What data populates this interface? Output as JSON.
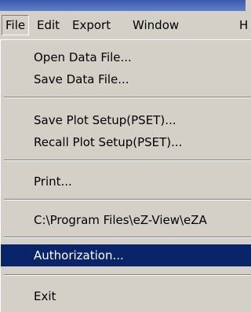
{
  "menubar": {
    "items": [
      {
        "label": "File"
      },
      {
        "label": "Edit"
      },
      {
        "label": "Export"
      },
      {
        "label": "Window"
      },
      {
        "label": "H"
      }
    ]
  },
  "file_menu": {
    "items": [
      {
        "label": "Open Data File..."
      },
      {
        "label": "Save Data File..."
      },
      {
        "label": "Save Plot Setup(PSET)..."
      },
      {
        "label": "Recall Plot Setup(PSET)..."
      },
      {
        "label": "Print..."
      },
      {
        "label": "C:\\Program Files\\eZ-View\\eZA"
      },
      {
        "label": "Authorization..."
      },
      {
        "label": "Exit"
      }
    ],
    "highlighted": "Authorization..."
  },
  "colors": {
    "menu_bg": "#d4d0c8",
    "highlight": "#0a246a",
    "title_bar": "#3c5aa8"
  }
}
